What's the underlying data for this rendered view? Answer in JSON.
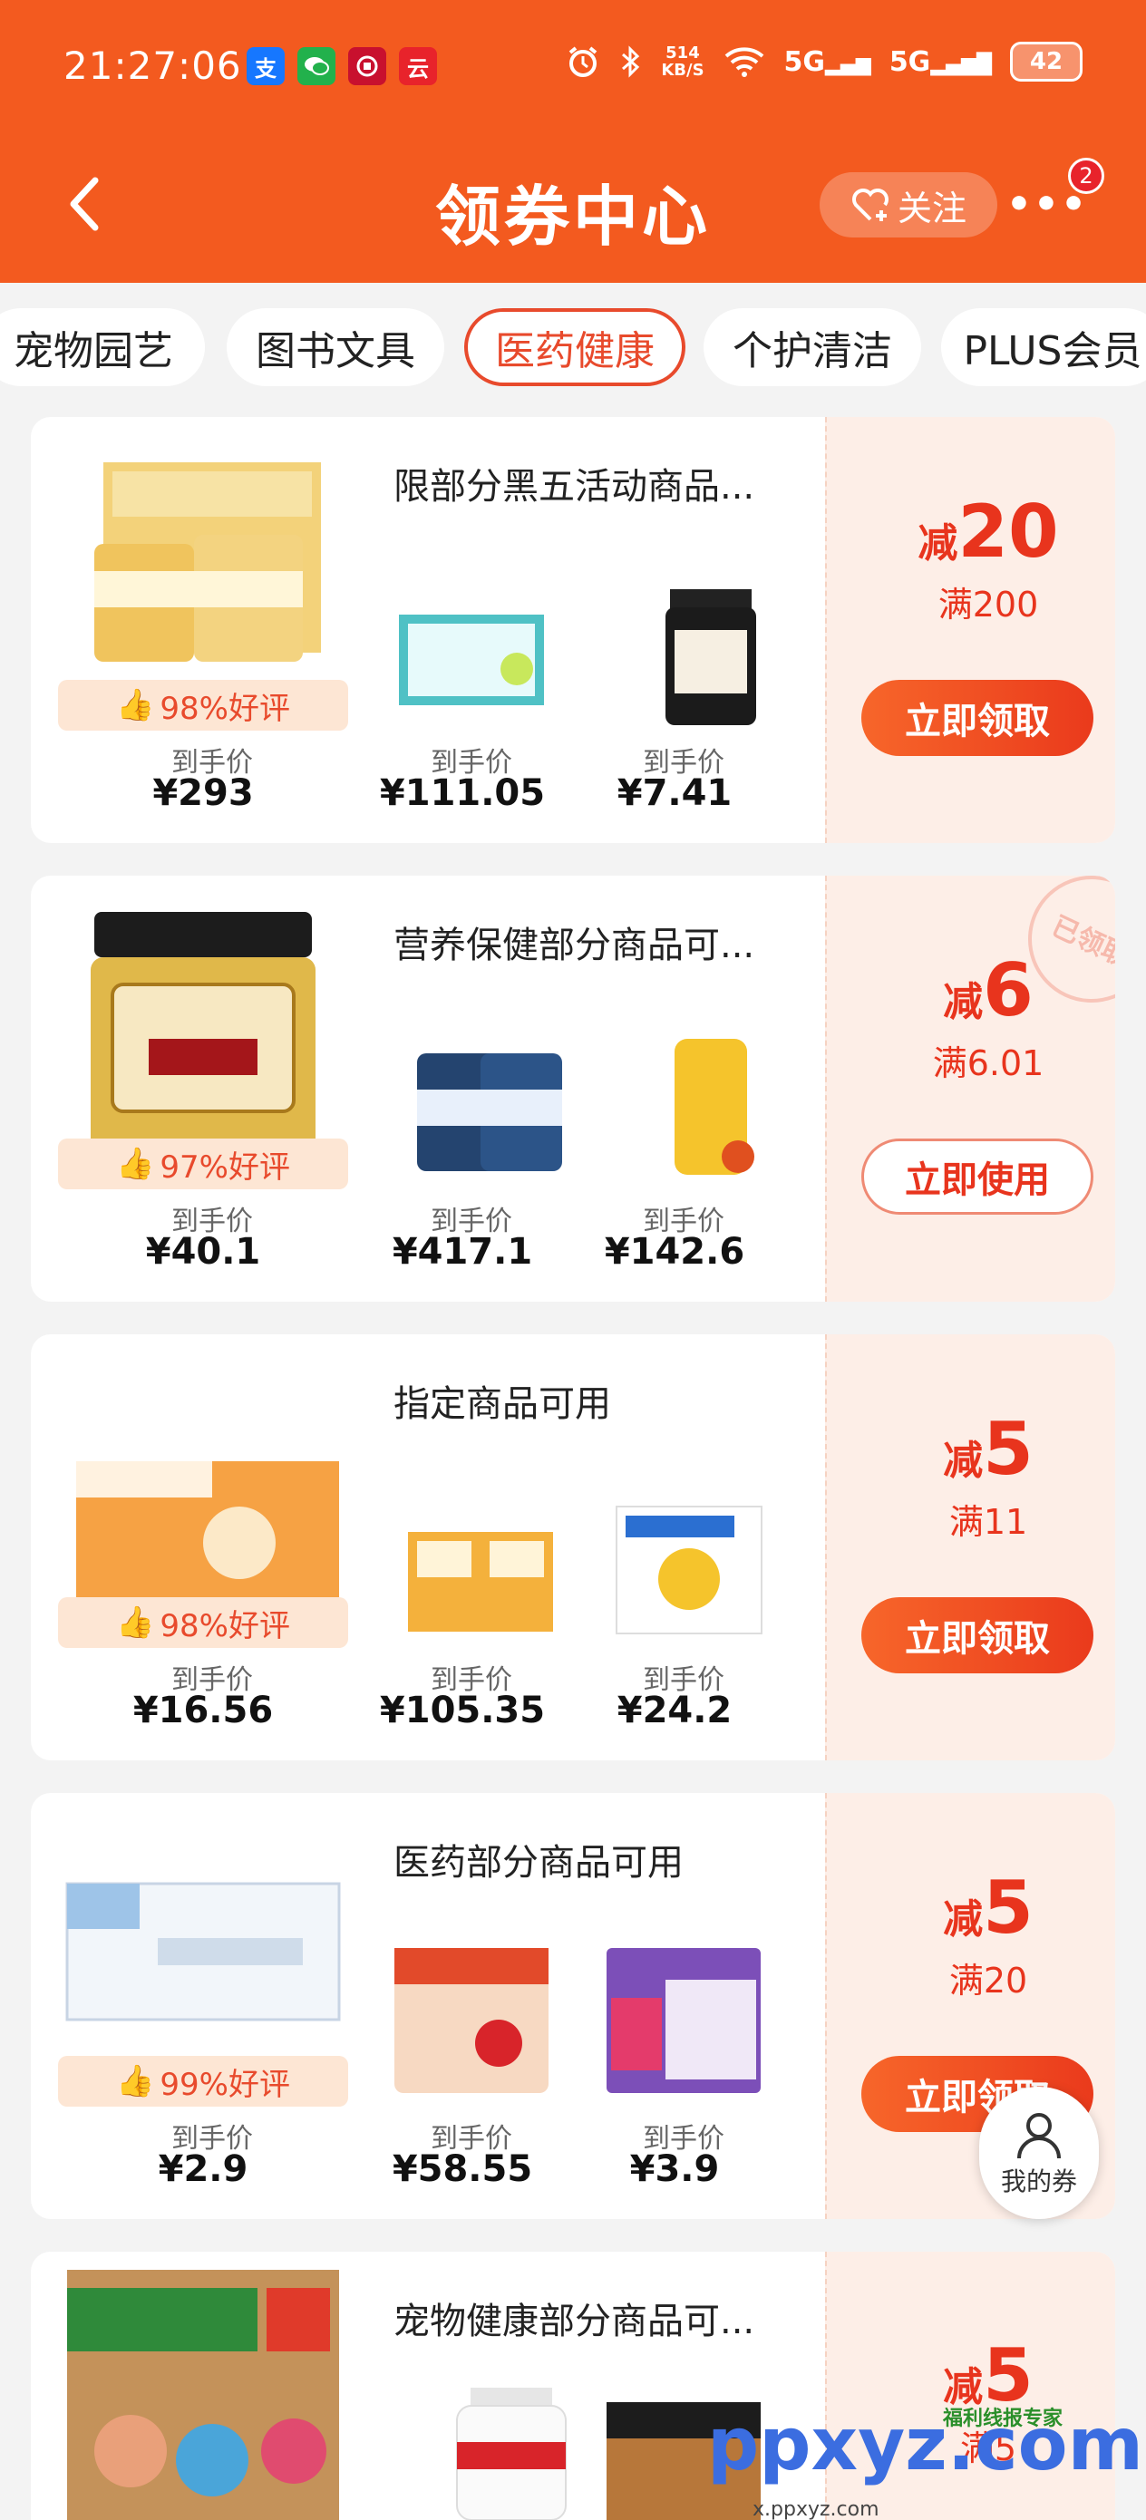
{
  "status_bar": {
    "time": "21:27:06",
    "speed_value": "514",
    "speed_unit": "KB/S",
    "signal_1": "5G",
    "signal_2": "5G",
    "battery": "42",
    "app_icons": [
      {
        "label": "支",
        "color": "#1677ff"
      },
      {
        "label": "💬",
        "color": "#22b14c"
      },
      {
        "label": "◉",
        "color": "#c8102e"
      },
      {
        "label": "云",
        "color": "#e8232b"
      }
    ]
  },
  "header": {
    "title": "领券中心",
    "follow_label": "关注",
    "more_badge": "2",
    "color": "#f35a1f"
  },
  "tabs": [
    {
      "label": "宠物园艺",
      "active": false
    },
    {
      "label": "图书文具",
      "active": false
    },
    {
      "label": "医药健康",
      "active": true
    },
    {
      "label": "个护清洁",
      "active": false
    },
    {
      "label": "PLUS会员",
      "active": false
    }
  ],
  "coupons": [
    {
      "title": "限部分黑五活动商品...",
      "rating": "98%好评",
      "price_label": "到手价",
      "prices": [
        "¥293",
        "¥111.05",
        "¥7.41"
      ],
      "discount_prefix": "减",
      "discount": "20",
      "threshold": "满200",
      "button": "立即领取",
      "claimed": false
    },
    {
      "title": "营养保健部分商品可...",
      "rating": "97%好评",
      "price_label": "到手价",
      "prices": [
        "¥40.1",
        "¥417.1",
        "¥142.6"
      ],
      "discount_prefix": "减",
      "discount": "6",
      "threshold": "满6.01",
      "button": "立即使用",
      "claimed": true,
      "stamp": "已领取"
    },
    {
      "title": "指定商品可用",
      "rating": "98%好评",
      "price_label": "到手价",
      "prices": [
        "¥16.56",
        "¥105.35",
        "¥24.2"
      ],
      "discount_prefix": "减",
      "discount": "5",
      "threshold": "满11",
      "button": "立即领取",
      "claimed": false
    },
    {
      "title": "医药部分商品可用",
      "rating": "99%好评",
      "price_label": "到手价",
      "prices": [
        "¥2.9",
        "¥58.55",
        "¥3.9"
      ],
      "discount_prefix": "减",
      "discount": "5",
      "threshold": "满20",
      "button": "立即领取",
      "claimed": false
    },
    {
      "title": "宠物健康部分商品可...",
      "discount_prefix": "减",
      "discount": "5",
      "threshold": "满5"
    }
  ],
  "floating": {
    "label": "我的券"
  },
  "watermark": {
    "text": "ppxyz.com",
    "url": "x.ppxyz.com",
    "badge": "福利线报专家"
  }
}
